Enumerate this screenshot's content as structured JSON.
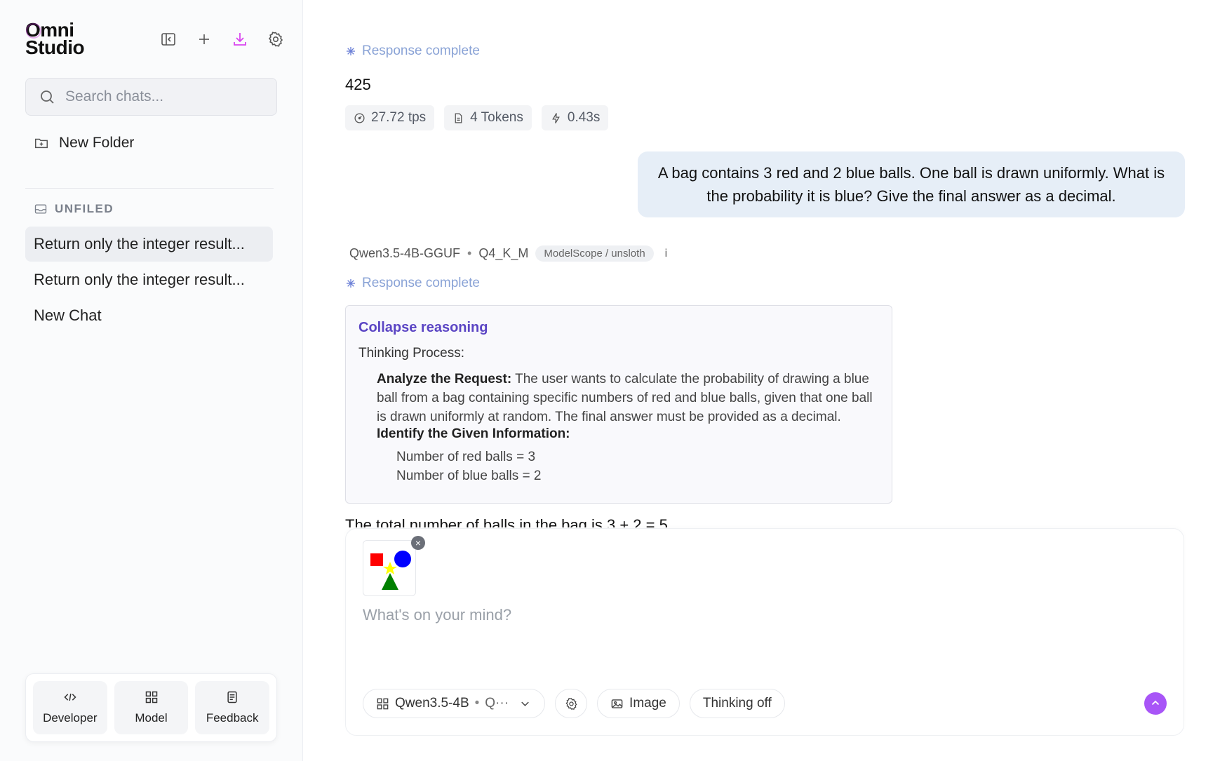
{
  "sidebar": {
    "logo_line1": "Omni",
    "logo_line2": "Studio",
    "search_placeholder": "Search chats...",
    "new_folder_label": "New Folder",
    "section_label": "UNFILED",
    "chats": [
      {
        "label": "Return only the integer result..."
      },
      {
        "label": "Return only the integer result..."
      },
      {
        "label": "New Chat"
      }
    ],
    "bottom_tabs": [
      {
        "label": "Developer"
      },
      {
        "label": "Model"
      },
      {
        "label": "Feedback"
      }
    ]
  },
  "main": {
    "first_response": {
      "status": "Response complete",
      "answer": "425",
      "stats": [
        {
          "label": "27.72 tps",
          "icon": "gauge-icon"
        },
        {
          "label": "4 Tokens",
          "icon": "document-icon"
        },
        {
          "label": "0.43s",
          "icon": "bolt-icon"
        }
      ]
    },
    "user_message": "A bag contains 3 red and 2 blue balls. One ball is drawn uniformly. What is the probability it is blue? Give the final answer as a decimal.",
    "model_info": {
      "model_name": "Qwen3.5-4B-GGUF",
      "dot": "•",
      "quant": "Q4_K_M",
      "source_badge": "ModelScope / unsloth",
      "info": "i"
    },
    "second_response": {
      "status": "Response complete",
      "collapse_label": "Collapse reasoning",
      "thinking_title": "Thinking Process:",
      "analyze_heading": "Analyze the Request:",
      "analyze_text": "The user wants to calculate the probability of drawing a blue ball from a bag containing specific numbers of red and blue balls, given that one ball is drawn uniformly at random. The final answer must be provided as a decimal.",
      "identify_heading": "Identify the Given Information:",
      "given": [
        "Number of red balls = 3",
        "Number of blue balls = 2"
      ],
      "total_line": "The total number of balls in the bag is 3 + 2 = 5"
    },
    "composer": {
      "placeholder": "What's on your mind?",
      "attachment_close": "×",
      "model_pill": "Qwen3.5-4B",
      "model_pill_dot": "•",
      "model_pill_more": "Q···",
      "image_label": "Image",
      "thinking_label": "Thinking off"
    },
    "colors": {
      "accent": "#a855f7",
      "status_blue": "#8aa3d6",
      "collapse_purple": "#5b45c4",
      "user_bubble": "#e6eef7"
    }
  }
}
